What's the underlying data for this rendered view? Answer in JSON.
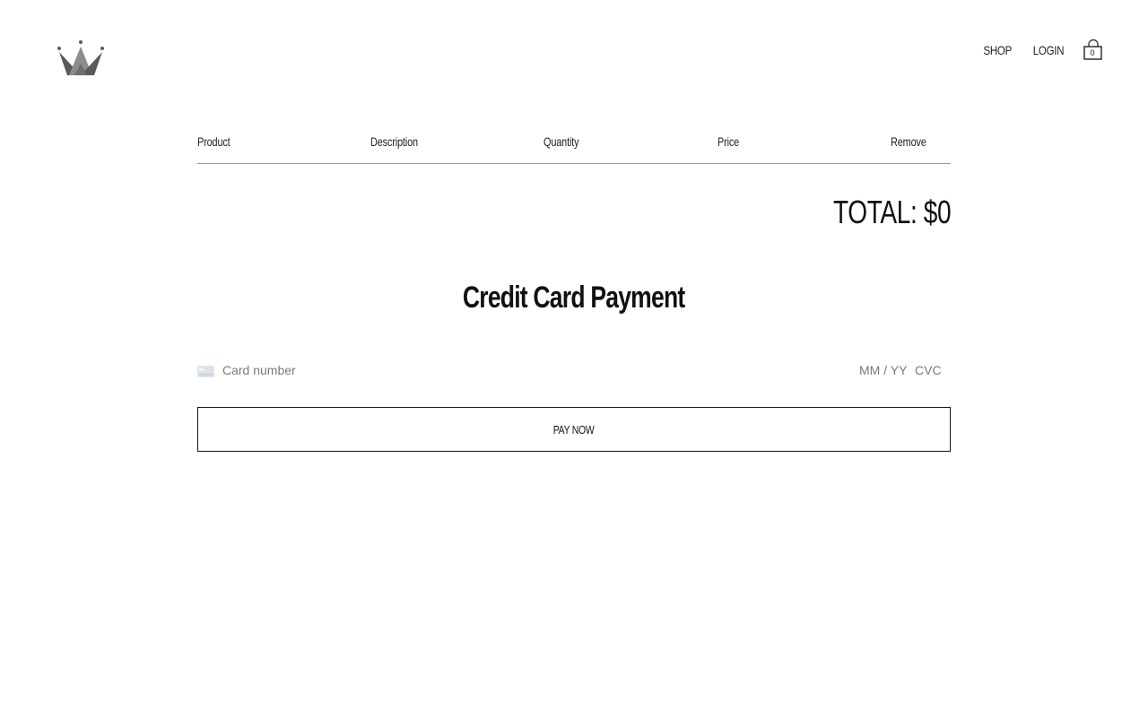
{
  "header": {
    "logo_icon": "crown-icon",
    "nav": {
      "shop_label": "SHOP",
      "login_label": "LOGIN"
    },
    "cart": {
      "icon": "shopping-bag-icon",
      "count": "0"
    }
  },
  "cart_table": {
    "columns": [
      "Product",
      "Description",
      "Quantity",
      "Price",
      "Remove"
    ],
    "rows": [],
    "total_label": "TOTAL: $0"
  },
  "payment": {
    "title": "Credit Card Payment",
    "card_icon": "credit-card-icon",
    "card_number_placeholder": "Card number",
    "expiry_placeholder": "MM / YY",
    "cvc_placeholder": "CVC",
    "pay_button_label": "PAY NOW"
  },
  "colors": {
    "text": "#111111",
    "logo_dark": "#5a5a5a",
    "logo_light": "#9a9a9a",
    "divider": "#9a9a9a",
    "placeholder": "#7a7a7a"
  }
}
